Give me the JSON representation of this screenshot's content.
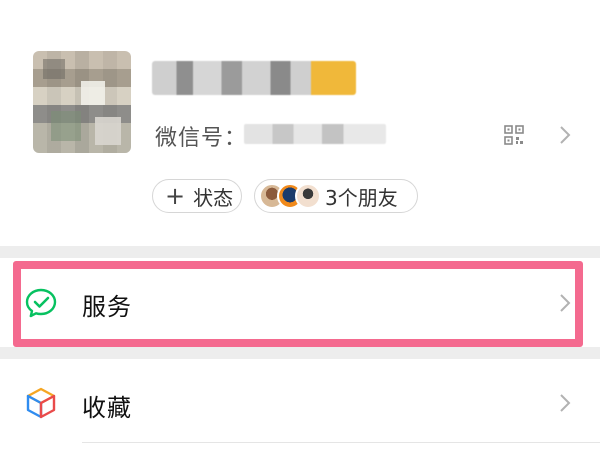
{
  "profile": {
    "wechat_id_label": "微信号：",
    "qr_icon": "qr-code-icon",
    "chevron_icon": "chevron-right-icon"
  },
  "chips": {
    "status": {
      "icon": "plus-icon",
      "label": "状态"
    },
    "friends": {
      "label": "3个朋友"
    }
  },
  "menu": [
    {
      "label": "服务",
      "icon": "wechat-pay-check-icon",
      "icon_color": "#07c160",
      "highlighted": true
    },
    {
      "label": "收藏",
      "icon": "favorites-cube-icon",
      "icon_colors": [
        "#f5a623",
        "#2f8cf0",
        "#e94b4b"
      ]
    }
  ],
  "colors": {
    "highlight": "#f46a8f",
    "divider": "#ededed",
    "chevron": "#b2b2b2"
  }
}
